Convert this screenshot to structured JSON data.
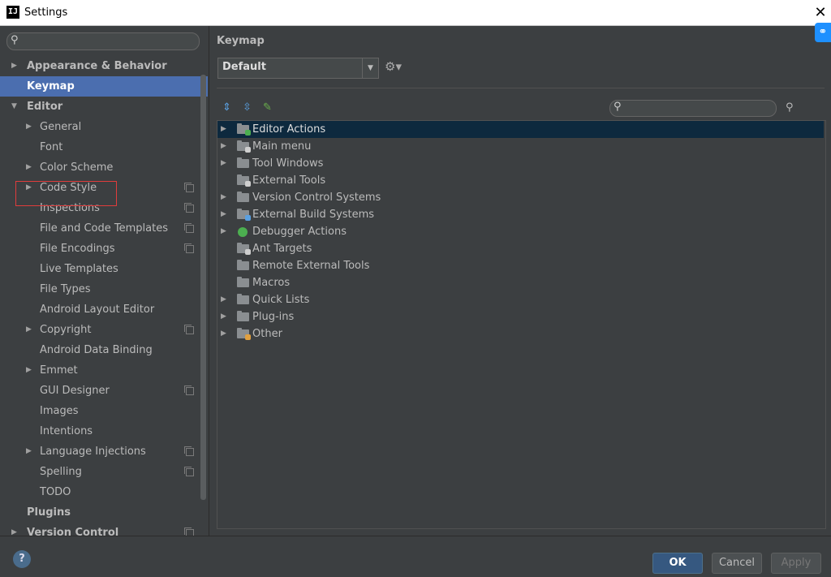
{
  "window": {
    "title": "Settings",
    "close_glyph": "✕",
    "app_icon_text": "IJ"
  },
  "sidebar": {
    "items": [
      {
        "label": "Appearance & Behavior",
        "level": 0,
        "arrow": "right",
        "bold": true
      },
      {
        "label": "Keymap",
        "level": 0,
        "arrow": "none",
        "bold": true,
        "selected": true
      },
      {
        "label": "Editor",
        "level": 0,
        "arrow": "down",
        "bold": true
      },
      {
        "label": "General",
        "level": 1,
        "arrow": "right"
      },
      {
        "label": "Font",
        "level": 1,
        "arrow": "none"
      },
      {
        "label": "Color Scheme",
        "level": 1,
        "arrow": "right"
      },
      {
        "label": "Code Style",
        "level": 1,
        "arrow": "right",
        "copy": true
      },
      {
        "label": "Inspections",
        "level": 1,
        "arrow": "none",
        "copy": true
      },
      {
        "label": "File and Code Templates",
        "level": 1,
        "arrow": "none",
        "copy": true
      },
      {
        "label": "File Encodings",
        "level": 1,
        "arrow": "none",
        "copy": true
      },
      {
        "label": "Live Templates",
        "level": 1,
        "arrow": "none"
      },
      {
        "label": "File Types",
        "level": 1,
        "arrow": "none"
      },
      {
        "label": "Android Layout Editor",
        "level": 1,
        "arrow": "none"
      },
      {
        "label": "Copyright",
        "level": 1,
        "arrow": "right",
        "copy": true
      },
      {
        "label": "Android Data Binding",
        "level": 1,
        "arrow": "none"
      },
      {
        "label": "Emmet",
        "level": 1,
        "arrow": "right"
      },
      {
        "label": "GUI Designer",
        "level": 1,
        "arrow": "none",
        "copy": true
      },
      {
        "label": "Images",
        "level": 1,
        "arrow": "none"
      },
      {
        "label": "Intentions",
        "level": 1,
        "arrow": "none"
      },
      {
        "label": "Language Injections",
        "level": 1,
        "arrow": "right",
        "copy": true
      },
      {
        "label": "Spelling",
        "level": 1,
        "arrow": "none",
        "copy": true
      },
      {
        "label": "TODO",
        "level": 1,
        "arrow": "none"
      },
      {
        "label": "Plugins",
        "level": 0,
        "arrow": "none",
        "bold": true
      },
      {
        "label": "Version Control",
        "level": 0,
        "arrow": "right",
        "bold": true,
        "copy": true
      }
    ]
  },
  "keymap": {
    "title": "Keymap",
    "selected_scheme": "Default",
    "actions": [
      {
        "label": "Editor Actions",
        "arrow": true,
        "selected": true,
        "icon": "editor-actions-icon",
        "badge": "#4caf50"
      },
      {
        "label": "Main menu",
        "arrow": true,
        "icon": "main-menu-icon",
        "badge": "#cfcfcf"
      },
      {
        "label": "Tool Windows",
        "arrow": true,
        "icon": "folder-icon"
      },
      {
        "label": "External Tools",
        "arrow": false,
        "icon": "external-tools-icon",
        "badge": "#cfcfcf"
      },
      {
        "label": "Version Control Systems",
        "arrow": true,
        "icon": "folder-icon"
      },
      {
        "label": "External Build Systems",
        "arrow": true,
        "icon": "build-systems-icon",
        "badge": "#5aa0e0"
      },
      {
        "label": "Debugger Actions",
        "arrow": true,
        "icon": "bug-icon"
      },
      {
        "label": "Ant Targets",
        "arrow": false,
        "icon": "ant-targets-icon",
        "badge": "#cfcfcf"
      },
      {
        "label": "Remote External Tools",
        "arrow": false,
        "icon": "folder-icon"
      },
      {
        "label": "Macros",
        "arrow": false,
        "icon": "folder-icon"
      },
      {
        "label": "Quick Lists",
        "arrow": true,
        "icon": "folder-icon"
      },
      {
        "label": "Plug-ins",
        "arrow": true,
        "icon": "folder-icon"
      },
      {
        "label": "Other",
        "arrow": true,
        "icon": "other-icon",
        "badge": "#e0a040"
      }
    ]
  },
  "footer": {
    "help_label": "?",
    "ok_label": "OK",
    "cancel_label": "Cancel",
    "apply_label": "Apply"
  },
  "colors": {
    "accent": "#4b6eaf",
    "highlight_border": "#e03c3c",
    "tree_selection": "#0d293e",
    "ok_button": "#365880"
  }
}
